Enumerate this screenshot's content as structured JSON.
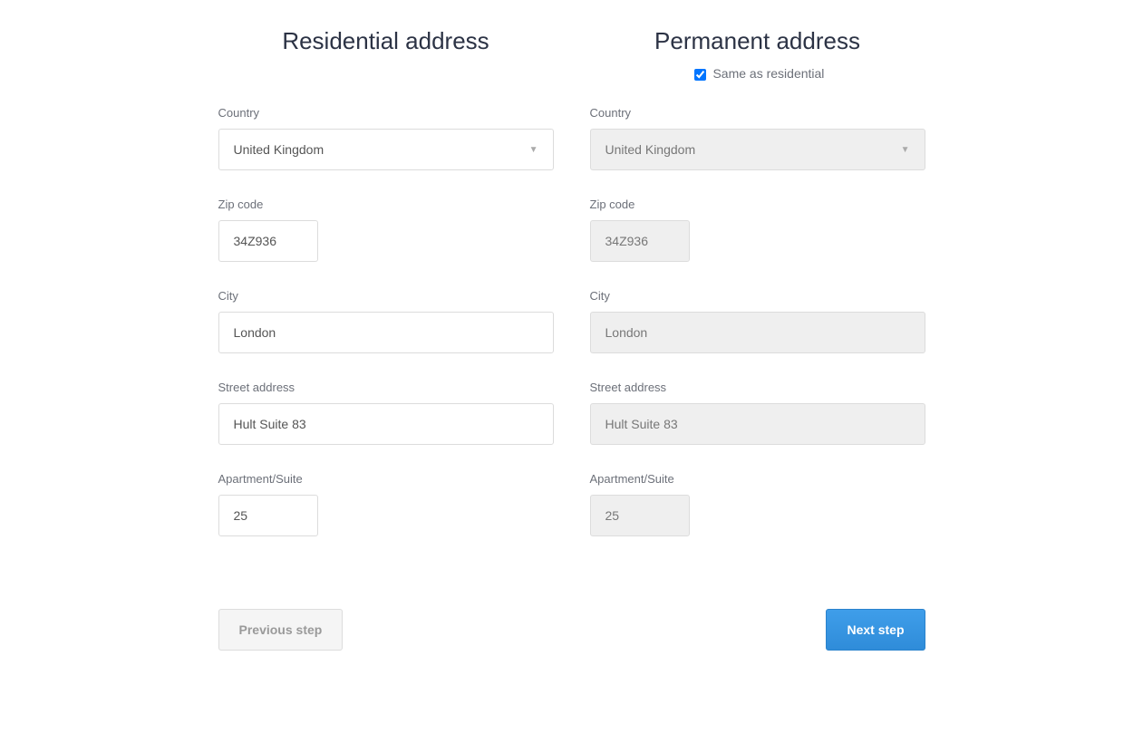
{
  "residential": {
    "title": "Residential address",
    "country_label": "Country",
    "country_value": "United Kingdom",
    "zip_label": "Zip code",
    "zip_value": "34Z936",
    "city_label": "City",
    "city_value": "London",
    "street_label": "Street address",
    "street_value": "Hult Suite 83",
    "apt_label": "Apartment/Suite",
    "apt_value": "25"
  },
  "permanent": {
    "title": "Permanent address",
    "same_label": "Same as residential",
    "same_checked": true,
    "country_label": "Country",
    "country_value": "United Kingdom",
    "zip_label": "Zip code",
    "zip_value": "34Z936",
    "city_label": "City",
    "city_value": "London",
    "street_label": "Street address",
    "street_value": "Hult Suite 83",
    "apt_label": "Apartment/Suite",
    "apt_value": "25"
  },
  "buttons": {
    "prev": "Previous step",
    "next": "Next step"
  }
}
